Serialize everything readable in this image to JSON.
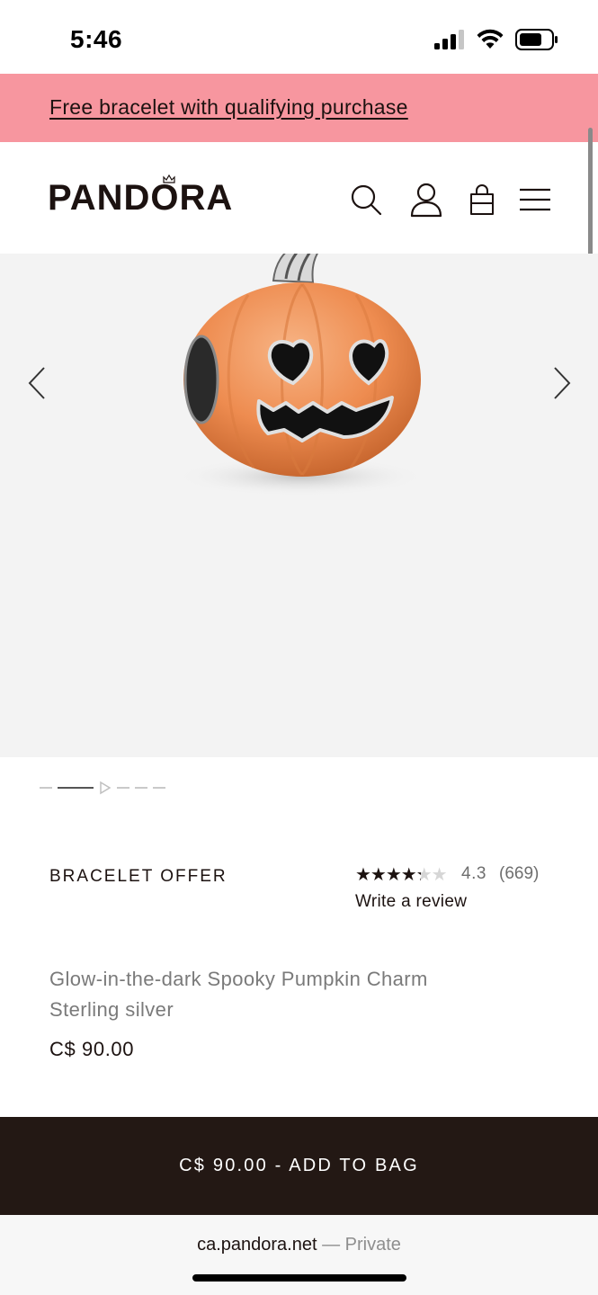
{
  "status_bar": {
    "time": "5:46",
    "icons": [
      "signal-icon",
      "wifi-icon",
      "battery-icon"
    ]
  },
  "promo": {
    "text": "Free bracelet with qualifying purchase",
    "background": "#f7969f"
  },
  "header": {
    "brand": "PANDORA",
    "icons": [
      "search-icon",
      "account-icon",
      "bag-icon",
      "menu-icon"
    ]
  },
  "gallery": {
    "current_index": 2,
    "total": 6,
    "prev_icon": "chevron-left-icon",
    "next_icon": "chevron-right-icon"
  },
  "product": {
    "offer_label": "BRACELET OFFER",
    "rating_value": "4.3",
    "rating_count": "(669)",
    "rating": 4.3,
    "write_review": "Write a review",
    "name_line1": "Glow-in-the-dark Spooky Pumpkin Charm",
    "name_line2": "Sterling silver",
    "price": "C$ 90.00"
  },
  "cta": {
    "label": "C$ 90.00 - ADD TO BAG",
    "background": "#231814"
  },
  "browser": {
    "domain": "ca.pandora.net",
    "privacy": "— Private"
  }
}
